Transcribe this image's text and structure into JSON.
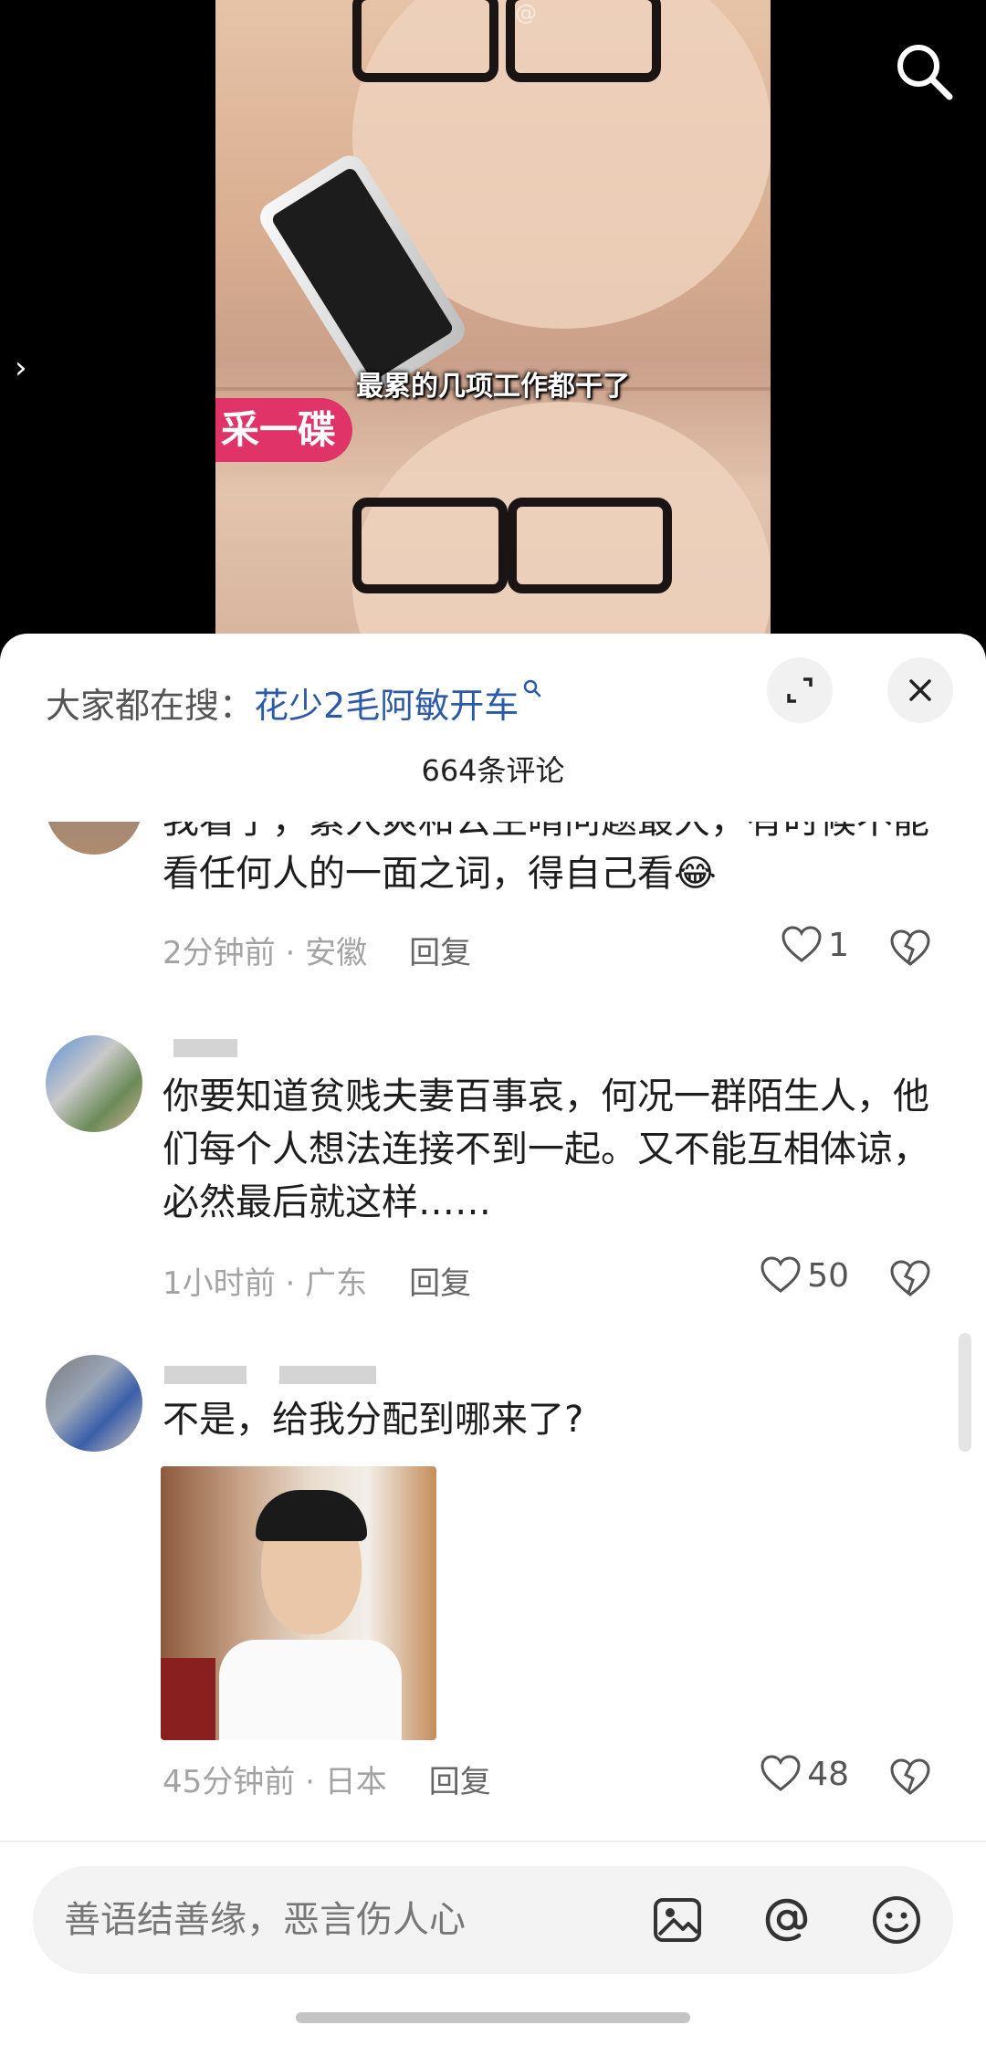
{
  "video": {
    "subtitle": "最累的几项工作都干了",
    "tag_text": "采一碟",
    "watermark": "@"
  },
  "search_bar": {
    "prefix": "大家都在搜：",
    "term": "花少2毛阿敏开车"
  },
  "comments_header": {
    "count_label": "664条评论"
  },
  "comments": [
    {
      "text": "我看了，素人爽和公主晴问题最大，有时候不能看任何人的一面之词，得自己看😂",
      "time": "2分钟前",
      "location": "安徽",
      "reply_label": "回复",
      "likes": "1"
    },
    {
      "text": "你要知道贫贱夫妻百事哀，何况一群陌生人，他们每个人想法连接不到一起。又不能互相体谅，必然最后就这样……",
      "time": "1小时前",
      "location": "广东",
      "reply_label": "回复",
      "likes": "50"
    },
    {
      "text": "不是，给我分配到哪来了?",
      "time": "45分钟前",
      "location": "日本",
      "reply_label": "回复",
      "likes": "48"
    }
  ],
  "meta_separator": " · ",
  "input": {
    "placeholder": "善语结善缘，恶言伤人心"
  },
  "icons": {
    "search": "search-icon",
    "expand": "expand-icon",
    "close": "close-icon",
    "like": "heart-icon",
    "dislike": "broken-heart-icon",
    "image": "image-icon",
    "mention": "at-icon",
    "emoji": "emoji-icon"
  },
  "colors": {
    "search_term": "#2c5aa8",
    "meta_text": "#a3a3a3",
    "sheet_bg": "#ffffff"
  }
}
